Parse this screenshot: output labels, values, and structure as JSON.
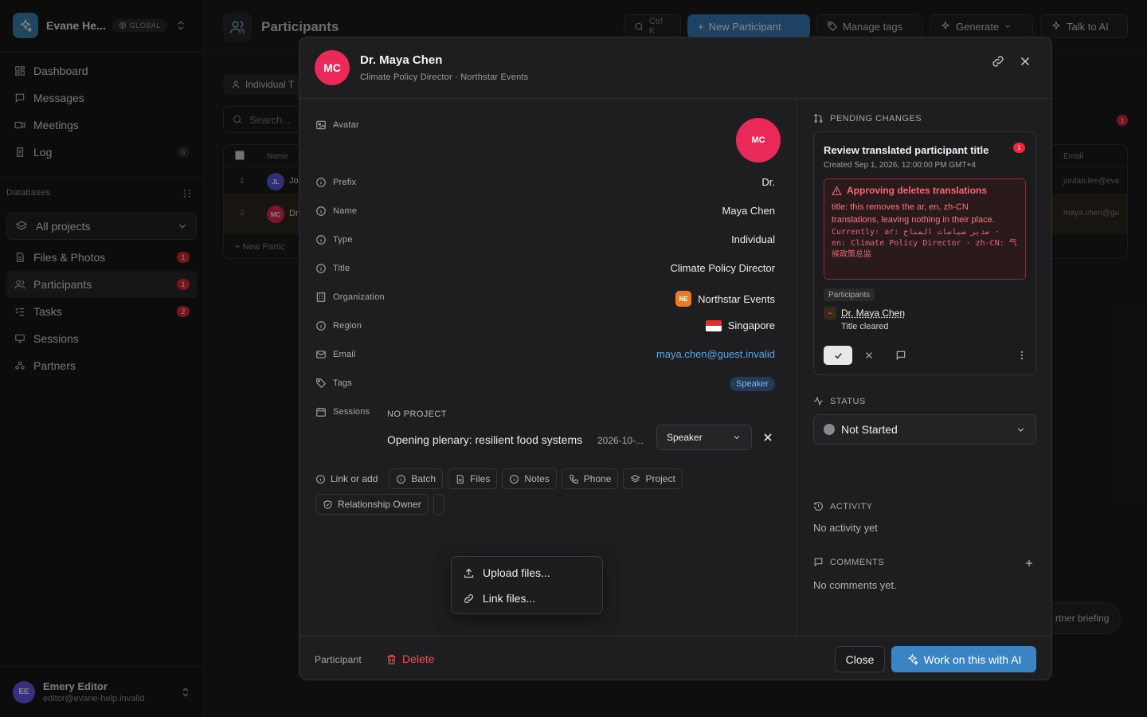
{
  "workspace": {
    "name": "Evane He...",
    "badge": "GLOBAL",
    "logo_color": "#3f86b9"
  },
  "nav_top": [
    {
      "label": "Dashboard",
      "icon": "dashboard-icon"
    },
    {
      "label": "Messages",
      "icon": "message-icon"
    },
    {
      "label": "Meetings",
      "icon": "video-icon"
    },
    {
      "label": "Log",
      "icon": "log-icon",
      "count": "6"
    }
  ],
  "databases": {
    "label": "Databases",
    "project_select": "All projects",
    "items": [
      {
        "label": "Files & Photos",
        "count": "1"
      },
      {
        "label": "Participants",
        "count": "1",
        "active": true
      },
      {
        "label": "Tasks",
        "count": "2"
      },
      {
        "label": "Sessions"
      },
      {
        "label": "Partners"
      }
    ]
  },
  "user": {
    "initials": "EE",
    "name": "Emery Editor",
    "email": "editor@evane-help.invalid"
  },
  "background": {
    "title": "Participants",
    "search_kbd": "Ctrl K",
    "new_button": "New Participant",
    "manage_tags": "Manage tags",
    "generate": "Generate",
    "talk_ai": "Talk to AI",
    "filter_chip": "Individual T",
    "search_placeholder": "Search...",
    "col_name": "Name",
    "col_email": "Email",
    "rows": [
      {
        "num": "1",
        "initials": "JL",
        "name": "Jo",
        "email": "jordan.lee@eva",
        "color": "#5a5cdd"
      },
      {
        "num": "2",
        "initials": "MC",
        "name": "Dr",
        "email": "maya.chen@gu",
        "color": "#e8295a"
      }
    ],
    "new_row": "New Partic",
    "dot": "1",
    "pill": "rtner briefing"
  },
  "modal": {
    "initials": "MC",
    "title": "Dr. Maya Chen",
    "subtitle": "Climate Policy Director · Northstar Events",
    "fields": {
      "avatar_label": "Avatar",
      "prefix_label": "Prefix",
      "prefix": "Dr.",
      "name_label": "Name",
      "name": "Maya Chen",
      "type_label": "Type",
      "type": "Individual",
      "title_label": "Title",
      "title": "Climate Policy Director",
      "org_label": "Organization",
      "org_initials": "NE",
      "org": "Northstar Events",
      "region_label": "Region",
      "region": "Singapore",
      "email_label": "Email",
      "email": "maya.chen@guest.invalid",
      "tags_label": "Tags",
      "tag": "Speaker",
      "sessions_label": "Sessions"
    },
    "session": {
      "project": "NO PROJECT",
      "title": "Opening plenary: resilient food systems",
      "date": "2026-10-...",
      "role": "Speaker"
    },
    "chips": [
      "Link or add",
      "Batch",
      "Files",
      "Notes",
      "Phone",
      "Project",
      "Relationship Owner"
    ],
    "dropdown": [
      "Upload files...",
      "Link files..."
    ],
    "pending": {
      "header": "PENDING CHANGES",
      "title": "Review translated participant title",
      "badge": "1",
      "created": "Created Sep 1, 2026, 12:00:00 PM GMT+4",
      "warn_title": "Approving deletes translations",
      "warn_text": "title: this removes the ar, en, zh-CN translations, leaving nothing in their place.",
      "warn_mono": "Currently: ar: مدير سياسات المناخ · en: Climate Policy Director · zh-CN: 气候政策总监",
      "table_tag": "Participants",
      "entity": "Dr. Maya Chen",
      "change": "Title cleared"
    },
    "status": {
      "header": "STATUS",
      "value": "Not Started"
    },
    "activity": {
      "header": "ACTIVITY",
      "empty": "No activity yet"
    },
    "comments": {
      "header": "COMMENTS",
      "empty": "No comments yet."
    },
    "footer": {
      "label": "Participant",
      "delete": "Delete",
      "close": "Close",
      "ai": "Work on this with AI"
    }
  },
  "colors": {
    "accent": "#3b84c4",
    "danger": "#e5293c",
    "avatar": "#e8295a"
  }
}
